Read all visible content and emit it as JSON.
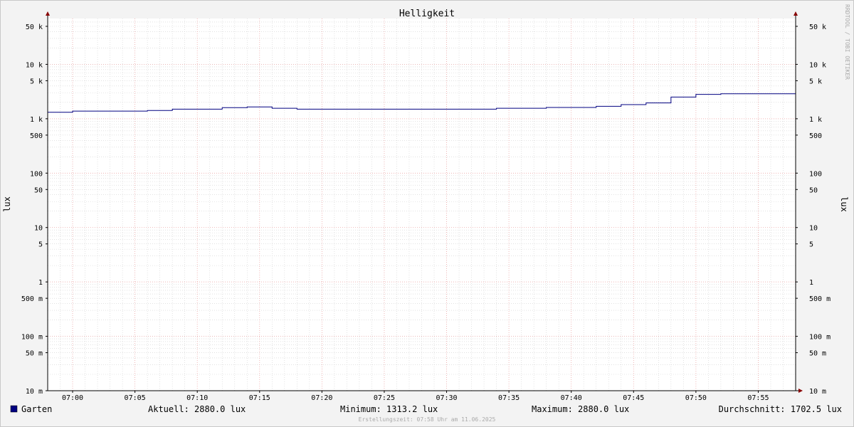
{
  "colors": {
    "background": "#f3f3f3",
    "canvas": "#ffffff",
    "series": "#000080",
    "major_grid": "#f0a0a0",
    "minor_grid": "#d0d0d0",
    "axis": "#000000",
    "arrow": "#880000",
    "watermark": "#aaaaaa"
  },
  "watermark": "RRDTOOL / TOBI OETIKER",
  "footer": {
    "created": "Erstellungszeit: 07:58 Uhr am 11.06.2025"
  },
  "legend": {
    "series_name": "Garten",
    "current": "Aktuell: 2880.0 lux",
    "minimum": "Minimum: 1313.2 lux",
    "maximum": "Maximum: 2880.0 lux",
    "average": "Durchschnitt: 1702.5 lux"
  },
  "chart_data": {
    "type": "line",
    "title": "Helligkeit",
    "xlabel": "",
    "ylabel": "lux",
    "ylabel_right": "lux",
    "y_scale": "log",
    "ylim": [
      0.01,
      70000
    ],
    "xlim": [
      "06:58",
      "07:58"
    ],
    "grid": true,
    "legend_position": "bottom-left",
    "x_ticks": [
      "07:00",
      "07:05",
      "07:10",
      "07:15",
      "07:20",
      "07:25",
      "07:30",
      "07:35",
      "07:40",
      "07:45",
      "07:50",
      "07:55"
    ],
    "y_ticks": [
      {
        "value": 0.01,
        "label": "10 m"
      },
      {
        "value": 0.05,
        "label": "50 m"
      },
      {
        "value": 0.1,
        "label": "100 m"
      },
      {
        "value": 0.5,
        "label": "500 m"
      },
      {
        "value": 1,
        "label": "1"
      },
      {
        "value": 5,
        "label": "5"
      },
      {
        "value": 10,
        "label": "10"
      },
      {
        "value": 50,
        "label": "50"
      },
      {
        "value": 100,
        "label": "100"
      },
      {
        "value": 500,
        "label": "500"
      },
      {
        "value": 1000,
        "label": "1 k"
      },
      {
        "value": 5000,
        "label": "5 k"
      },
      {
        "value": 10000,
        "label": "10 k"
      },
      {
        "value": 50000,
        "label": "50 k"
      }
    ],
    "series": [
      {
        "name": "Garten",
        "x": [
          "06:58",
          "07:00",
          "07:06",
          "07:08",
          "07:12",
          "07:14",
          "07:16",
          "07:18",
          "07:34",
          "07:38",
          "07:42",
          "07:44",
          "07:46",
          "07:48",
          "07:50",
          "07:52",
          "07:58"
        ],
        "values": [
          1313.2,
          1380,
          1420,
          1500,
          1600,
          1650,
          1560,
          1500,
          1560,
          1610,
          1690,
          1820,
          1950,
          2500,
          2800,
          2880,
          2880
        ]
      }
    ]
  }
}
